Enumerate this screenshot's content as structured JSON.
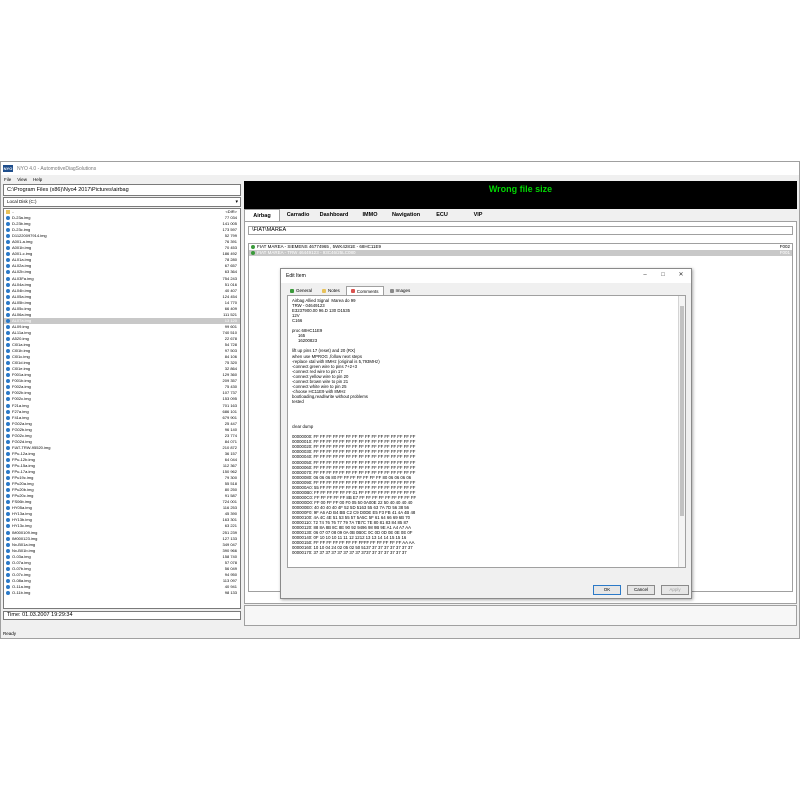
{
  "app": {
    "title": "NYO 4.0 - AutomotiveDiagSolutions",
    "menu": [
      "File",
      "View",
      "Help"
    ],
    "status": "Ready"
  },
  "left": {
    "path": "C:\\Program Files (x86)\\Nyo4 2017\\Pictures\\airbag",
    "drive": "Local Disk (C:)",
    "time": "Time: 01.03.2007 19:29:34",
    "files": [
      {
        "name": "..",
        "size": "<DIR>"
      },
      {
        "name": "D-23a.img",
        "size": "77 034"
      },
      {
        "name": "D-23b.img",
        "size": "141 005"
      },
      {
        "name": "D-23c.img",
        "size": "173 597"
      },
      {
        "name": "D11220097914.img",
        "size": "52 799"
      },
      {
        "name": "A001-a.img",
        "size": "76 391"
      },
      {
        "name": "A001b.img",
        "size": "70 453"
      },
      {
        "name": "A001-c.img",
        "size": "186 492"
      },
      {
        "name": "AL01a.img",
        "size": "78 280"
      },
      {
        "name": "AL02a.img",
        "size": "67 657"
      },
      {
        "name": "AL02b.img",
        "size": "63 364"
      },
      {
        "name": "AL03Fa.img",
        "size": "754 243"
      },
      {
        "name": "AL04a.img",
        "size": "51 016"
      },
      {
        "name": "AL04b.img",
        "size": "40 407"
      },
      {
        "name": "AL05a.img",
        "size": "124 454"
      },
      {
        "name": "AL05b.img",
        "size": "14 770"
      },
      {
        "name": "AL05c.img",
        "size": "66 409"
      },
      {
        "name": "AL06a.img",
        "size": "111 521"
      },
      {
        "name": "AL07a.img",
        "size": "13 120"
      },
      {
        "name": "AL09.img",
        "size": "99 601"
      },
      {
        "name": "AL11a.img",
        "size": "740 510"
      },
      {
        "name": "A520.img",
        "size": "22 678"
      },
      {
        "name": "Cl01a.img",
        "size": "54 728"
      },
      {
        "name": "Cl01b.img",
        "size": "97 503"
      },
      {
        "name": "Cl01c.img",
        "size": "84 106"
      },
      {
        "name": "Cl01d.img",
        "size": "75 320"
      },
      {
        "name": "Cl01e.img",
        "size": "32 864"
      },
      {
        "name": "F001a.img",
        "size": "129 360"
      },
      {
        "name": "F001b.img",
        "size": "209 357"
      },
      {
        "name": "F002a.img",
        "size": "75 430"
      },
      {
        "name": "F002b.img",
        "size": "107 737"
      },
      {
        "name": "F002c.img",
        "size": "153 095"
      },
      {
        "name": "F21a.img",
        "size": "701 163"
      },
      {
        "name": "F27a.img",
        "size": "686 101"
      },
      {
        "name": "F41a.img",
        "size": "679 901"
      },
      {
        "name": "FG02a.img",
        "size": "25 447"
      },
      {
        "name": "FG02b.img",
        "size": "96 140"
      },
      {
        "name": "FG02c.img",
        "size": "23 774"
      },
      {
        "name": "FG02d.img",
        "size": "84 071"
      },
      {
        "name": "FIAT-TRW-95520.img",
        "size": "210 872"
      },
      {
        "name": "FPu-12a.img",
        "size": "36 157"
      },
      {
        "name": "FPu-12b.img",
        "size": "64 044"
      },
      {
        "name": "FPu-15a.img",
        "size": "112 367"
      },
      {
        "name": "FPu-17a.img",
        "size": "150 962"
      },
      {
        "name": "FPu19c.img",
        "size": "79 300"
      },
      {
        "name": "FPu20a.img",
        "size": "55 518"
      },
      {
        "name": "FPu20b.img",
        "size": "80 250"
      },
      {
        "name": "FPu20c.img",
        "size": "91 587"
      },
      {
        "name": "FS06b.img",
        "size": "724 001"
      },
      {
        "name": "HY05a.img",
        "size": "116 253"
      },
      {
        "name": "HY13a.img",
        "size": "45 390"
      },
      {
        "name": "HY13b.img",
        "size": "163 301"
      },
      {
        "name": "HY13c.img",
        "size": "63 221"
      },
      {
        "name": "IM000109.img",
        "size": "251 239"
      },
      {
        "name": "IM000123.img",
        "size": "127 133"
      },
      {
        "name": "Nx-B01a.img",
        "size": "349 047"
      },
      {
        "name": "Nx-B01b.img",
        "size": "390 966"
      },
      {
        "name": "O-03a.img",
        "size": "158 740"
      },
      {
        "name": "O-07a.img",
        "size": "57 078"
      },
      {
        "name": "O-07b.img",
        "size": "56 049"
      },
      {
        "name": "O-07c.img",
        "size": "94 950"
      },
      {
        "name": "O-08a.img",
        "size": "113 097"
      },
      {
        "name": "O-11a.img",
        "size": "40 941"
      },
      {
        "name": "O-11b.img",
        "size": "98 133"
      }
    ]
  },
  "right": {
    "banner": "Wrong file size",
    "tabs": [
      "Airbag",
      "Carradio",
      "Dashboard",
      "IMMO",
      "Navigation",
      "ECU",
      "VIP"
    ],
    "breadcrumb": "\\FIAT\\MAREA",
    "list": [
      {
        "name": "FIAT MAREA - SIEMENS 46774965 , 5WK4281E - 68HC11E9",
        "code": "F002"
      },
      {
        "name": "FIAT MAREA - TRW 46449123 - 93C46/25LC080",
        "code": "F001"
      }
    ]
  },
  "dialog": {
    "title": "Edit Item",
    "tabs": [
      "General",
      "Notes",
      "Comments",
      "Images"
    ],
    "memo": "Airbag Allied Signal  Marea do 99\nTRW - 04649123\nE3237900.00 96.D 130 D1535\n12V\nC166\n\nproc 68HC11E9\n     165\n     16200823\n\nlift up pins 17 (reset) and 20 (RX)\nwhen use MPROG ,follow next steps\n-replace xtal with 8MHz (original is 5,793MHz)\n-connect green wire to pins 7+2+3\n-connect red wire to pin 17\n-connect yellow wire to pin 20\n-connect brown wire to pin 21\n-connect white wire to pin 25\n-choose HC11E9 with 8MHz\nbootloading,read/write without problems\ntested\n\n\n\n\nclear dump\n\n00000000: FF FF FF FF FF FF FF FF FF FF FF FF FF FF FF FF\n00000010: FF FF FF FF FF FF FF FF FF FF FF FF FF FF FF FF\n00000020: FF FF FF FF FF FF FF FF FF FF FF FF FF FF FF FF\n00000030: FF FF FF FF FF FF FF FF FF FF FF FF FF FF FF FF\n00000040: FF FF FF FF FF FF FF FF FF FF FF FF FF FF FF FF\n00000050: FF FF FF FF FF FF FF FF FF FF FF FF FF FF FF FF\n00000060: FF FF FF FF FF FF FF FF FF FF FF FF FF FF FF FF\n00000070: FF FF FF FF FF FF FF FF FF FF FF FF FF FF FF FF\n00000080: 06 06 06 80 FF FF FF FF FF FF FF 80 06 06 06 06\n00000090: FF FF FF FF FF FF FF FF FF FF FF FF FF FF FF FF\n000000A0: 55 FF FF FF FF FF FF FF FF FF FF FF FF FF FF FF\n000000B0: FF FF FF FF FF FF 01 FF FF FF FF FF FF FF FF FF\n000000C0: FF FF FF FF FF 8B E7 FF FF FF FF FF FF FF FF FF\n000000D0: FF 00 FF FF 00 F0 05 50 0A00E 22 50 40 40 40 40\n000000E0: 40 40 40 40 4F 52 5D 5163 55 63 7A 7D 56 38 56\n000000F0: 9F A6 AD B4 BB C2 C9 D0DE E5 F3 FB 41 4A 4B 48\n00000100: 4A 4C 4E 51 53 55 57 5A5C 5F 61 64 66 69 6B 70\n00000110: 72 74 76 76 77 79 7A 7B7C 7E 80 81 83 84 85 87\n00000120: 88 8A 8B 8C 8E 90 92 9496 98 9B 9E A1 A4 A7 AA\n00000130: 06 07 07 08 09 0A 0B 0B0C 0C 0D 0D 0E 0E 0E 0F\n00000140: 0F 10 10 10 11 11 12 1212 13 13 14 14 15 15 16\n00000150: FF FF FF FF FF FF FF FFFF FF FF FF FF FF AA AA\n00000160: 10 10 04 24 02 05 02 50 5137 37 37 37 37 37 37 37\n00000170: 37 37 37 37 37 37 37 37 3737 37 37 37 37 37 37",
    "buttons": {
      "ok": "OK",
      "cancel": "Cancel",
      "apply": "Apply"
    }
  },
  "colors": {
    "banner_bg": "#000000",
    "banner_text": "#00d400",
    "file_icon": "#2b79c7",
    "list_icon": "#3a9a3a"
  }
}
